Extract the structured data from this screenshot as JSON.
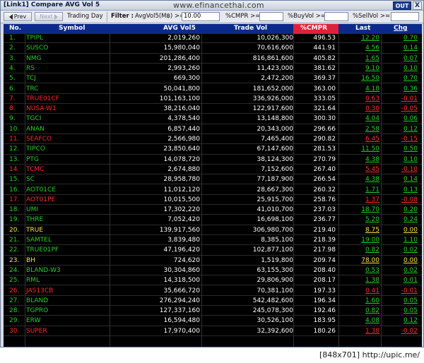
{
  "window": {
    "title": "[Link1] Compare AVG Vol 5",
    "watermark": "www.efinancethai.com",
    "out_label": "OUT",
    "close_label": "X"
  },
  "toolbar": {
    "prev_label": "Prev",
    "next_label": "Next",
    "trading_day_label": "Trading Day",
    "filter_label": "Filter :",
    "avgvol_label": "AvgVol5(M฿) >=",
    "avgvol_value": "10.00",
    "cmpr_label": "%CMPR >=",
    "cmpr_value": "",
    "buyvol_label": "%BuyVol >=",
    "buyvol_value": "",
    "sellvol_label": "%SellVol >=",
    "sellvol_value": ""
  },
  "table": {
    "headers": {
      "no": "No.",
      "symbol": "Symbol",
      "avg": "AVG Vol5",
      "trade": "Trade Vol",
      "cmpr": "%CMPR",
      "last": "Last",
      "chg": "Chg"
    },
    "colors": {
      "header_bg": "#0b2a8a",
      "cmpr_header_bg": "#e0203a",
      "up": "#22d022",
      "down": "#ff2a2a",
      "unchanged": "#ffe24a"
    },
    "rows": [
      {
        "no": "1.",
        "symbol": "TPIPL",
        "avg": "2,019,260",
        "trade": "10,026,300",
        "cmpr": "496.53",
        "last": "12.20",
        "chg": "0.70",
        "dir": "up"
      },
      {
        "no": "2.",
        "symbol": "SUSCO",
        "avg": "15,980,040",
        "trade": "70,616,600",
        "cmpr": "441.91",
        "last": "4.56",
        "chg": "0.14",
        "dir": "up"
      },
      {
        "no": "3.",
        "symbol": "NMG",
        "avg": "201,286,400",
        "trade": "816,861,600",
        "cmpr": "405.82",
        "last": "1.65",
        "chg": "0.07",
        "dir": "up"
      },
      {
        "no": "4.",
        "symbol": "RS",
        "avg": "2,993,260",
        "trade": "11,423,000",
        "cmpr": "381.62",
        "last": "9.10",
        "chg": "0.10",
        "dir": "up"
      },
      {
        "no": "5.",
        "symbol": "TCJ",
        "avg": "669,300",
        "trade": "2,472,200",
        "cmpr": "369.37",
        "last": "16.50",
        "chg": "0.70",
        "dir": "up"
      },
      {
        "no": "6.",
        "symbol": "TRC",
        "avg": "50,041,800",
        "trade": "181,652,000",
        "cmpr": "363.00",
        "last": "4.18",
        "chg": "0.36",
        "dir": "up"
      },
      {
        "no": "7.",
        "symbol": "TRUE01CF",
        "avg": "101,163,100",
        "trade": "336,926,000",
        "cmpr": "333.05",
        "last": "0.63",
        "chg": "-0.01",
        "dir": "down"
      },
      {
        "no": "8.",
        "symbol": "NUSA-W1",
        "avg": "38,216,040",
        "trade": "122,917,600",
        "cmpr": "321.64",
        "last": "0.30",
        "chg": "-0.05",
        "dir": "down"
      },
      {
        "no": "9.",
        "symbol": "TGCI",
        "avg": "4,378,540",
        "trade": "13,148,800",
        "cmpr": "300.30",
        "last": "4.04",
        "chg": "0.06",
        "dir": "up"
      },
      {
        "no": "10.",
        "symbol": "ANAN",
        "avg": "6,857,440",
        "trade": "20,343,000",
        "cmpr": "296.66",
        "last": "2.58",
        "chg": "0.12",
        "dir": "up"
      },
      {
        "no": "11.",
        "symbol": "SEAFCO",
        "avg": "2,566,980",
        "trade": "7,465,400",
        "cmpr": "290.82",
        "last": "6.45",
        "chg": "-0.15",
        "dir": "down"
      },
      {
        "no": "12.",
        "symbol": "TIPCO",
        "avg": "23,850,640",
        "trade": "67,147,600",
        "cmpr": "281.53",
        "last": "11.50",
        "chg": "0.50",
        "dir": "up"
      },
      {
        "no": "13.",
        "symbol": "PTG",
        "avg": "14,078,720",
        "trade": "38,124,300",
        "cmpr": "270.79",
        "last": "4.38",
        "chg": "0.10",
        "dir": "up"
      },
      {
        "no": "14.",
        "symbol": "TCMC",
        "avg": "2,674,880",
        "trade": "7,152,600",
        "cmpr": "267.40",
        "last": "5.45",
        "chg": "-0.10",
        "dir": "down"
      },
      {
        "no": "15.",
        "symbol": "SC",
        "avg": "28,958,780",
        "trade": "77,187,900",
        "cmpr": "266.54",
        "last": "4.38",
        "chg": "0.14",
        "dir": "up"
      },
      {
        "no": "16.",
        "symbol": "AOT01CE",
        "avg": "11,012,120",
        "trade": "28,667,300",
        "cmpr": "260.32",
        "last": "1.71",
        "chg": "0.13",
        "dir": "up"
      },
      {
        "no": "17.",
        "symbol": "AOT01PE",
        "avg": "10,015,500",
        "trade": "25,915,700",
        "cmpr": "258.76",
        "last": "1.37",
        "chg": "-0.08",
        "dir": "down"
      },
      {
        "no": "18.",
        "symbol": "UMI",
        "avg": "17,302,220",
        "trade": "41,010,700",
        "cmpr": "237.03",
        "last": "18.70",
        "chg": "0.20",
        "dir": "up"
      },
      {
        "no": "19.",
        "symbol": "THRE",
        "avg": "7,052,420",
        "trade": "16,698,100",
        "cmpr": "236.77",
        "last": "5.20",
        "chg": "0.24",
        "dir": "up"
      },
      {
        "no": "20.",
        "symbol": "TRUE",
        "avg": "139,917,560",
        "trade": "306,980,700",
        "cmpr": "219.40",
        "last": "8.75",
        "chg": "0.00",
        "dir": "unchanged"
      },
      {
        "no": "21.",
        "symbol": "SAMTEL",
        "avg": "3,839,480",
        "trade": "8,385,100",
        "cmpr": "218.39",
        "last": "19.00",
        "chg": "1.10",
        "dir": "up"
      },
      {
        "no": "22.",
        "symbol": "TRUE01PF",
        "avg": "47,196,420",
        "trade": "102,877,100",
        "cmpr": "217.98",
        "last": "0.82",
        "chg": "0.02",
        "dir": "up"
      },
      {
        "no": "23.",
        "symbol": "BH",
        "avg": "724,620",
        "trade": "1,519,800",
        "cmpr": "209.74",
        "last": "78.00",
        "chg": "0.00",
        "dir": "unchanged"
      },
      {
        "no": "24.",
        "symbol": "BLAND-W3",
        "avg": "30,304,860",
        "trade": "63,155,300",
        "cmpr": "208.40",
        "last": "0.53",
        "chg": "0.02",
        "dir": "up"
      },
      {
        "no": "25.",
        "symbol": "RML",
        "avg": "14,318,500",
        "trade": "29,806,900",
        "cmpr": "208.17",
        "last": "1.38",
        "chg": "0.01",
        "dir": "up"
      },
      {
        "no": "26.",
        "symbol": "JAS13CB",
        "avg": "35,666,720",
        "trade": "70,381,100",
        "cmpr": "197.33",
        "last": "0.41",
        "chg": "-0.01",
        "dir": "down"
      },
      {
        "no": "27.",
        "symbol": "BLAND",
        "avg": "276,294,240",
        "trade": "542,482,600",
        "cmpr": "196.34",
        "last": "1.60",
        "chg": "0.05",
        "dir": "up"
      },
      {
        "no": "28.",
        "symbol": "TGPRO",
        "avg": "127,337,160",
        "trade": "245,078,300",
        "cmpr": "192.46",
        "last": "0.82",
        "chg": "0.05",
        "dir": "up"
      },
      {
        "no": "29.",
        "symbol": "ERW",
        "avg": "16,594,480",
        "trade": "30,526,100",
        "cmpr": "183.95",
        "last": "4.08",
        "chg": "0.12",
        "dir": "up"
      },
      {
        "no": "30.",
        "symbol": "SUPER",
        "avg": "17,970,400",
        "trade": "32,392,600",
        "cmpr": "180.26",
        "last": "1.38",
        "chg": "-0.02",
        "dir": "down"
      }
    ]
  },
  "footer": {
    "text": "[848x701] http://upic.me/"
  }
}
